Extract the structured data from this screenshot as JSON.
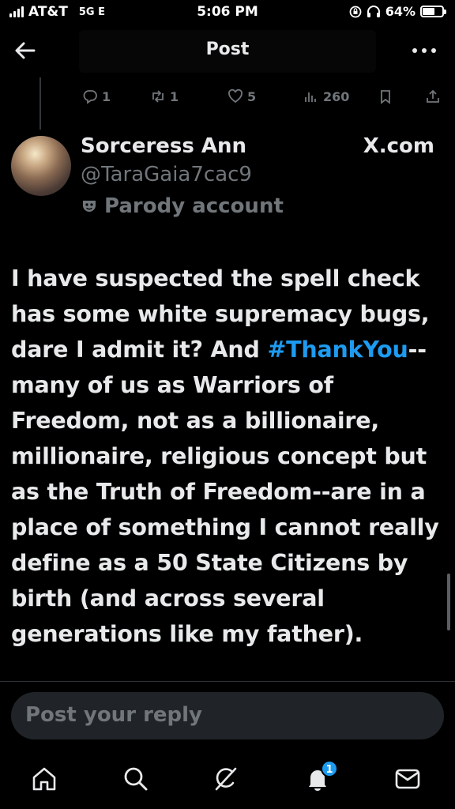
{
  "status_bar": {
    "carrier": "AT&T",
    "network": "5G E",
    "time": "5:06 PM",
    "battery": "64%",
    "battery_level": 0.64
  },
  "header": {
    "title": "Post",
    "back_icon": "arrow-left-icon",
    "more_icon": "more-horizontal-icon"
  },
  "engagement": {
    "replies": "1",
    "reposts": "1",
    "likes": "5",
    "views": "260"
  },
  "post": {
    "author_name": "Sorceress Ann",
    "handle": "@TaraGaia7cac9",
    "label": "Parody account",
    "source": "X.com",
    "body_part1": "I have suspected the spell check has some white supremacy bugs, dare I admit it? And ",
    "hashtag": "#ThankYou",
    "body_part2": "-- many of us as Warriors of Freedom, not as a billionaire, millionaire, religious concept but as the Truth of Freedom--are in a place of something I cannot really define as a 50 State Citizens by birth (and across several generations like my father)."
  },
  "reply": {
    "placeholder": "Post your reply"
  },
  "nav": {
    "items": [
      "home-icon",
      "search-icon",
      "grok-icon",
      "notifications-icon",
      "messages-icon"
    ],
    "notification_badge": "1"
  },
  "colors": {
    "background": "#000000",
    "text": "#e7e9ea",
    "muted": "#71767b",
    "accent": "#1d9bf0"
  }
}
